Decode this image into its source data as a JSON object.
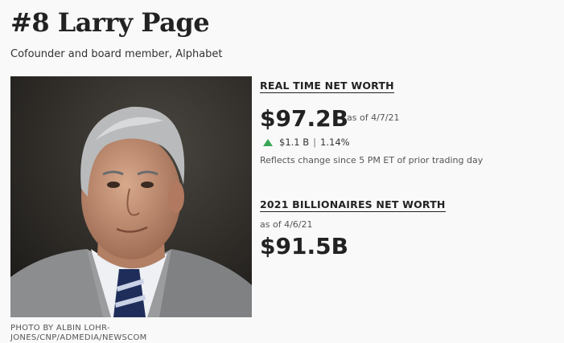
{
  "profile": {
    "rank_name": "#8 Larry Page",
    "subtitle": "Cofounder and board member, Alphabet",
    "photo_credit": "PHOTO BY ALBIN LOHR-JONES/CNP/ADMEDIA/NEWSCOM"
  },
  "realtime": {
    "label": "REAL TIME NET WORTH",
    "value": "$97.2B",
    "as_of": "as of 4/7/21",
    "change_amount": "$1.1 B",
    "change_sep": "|",
    "change_pct": "1.14%",
    "change_direction": "up",
    "note": "Reflects change since 5 PM ET of prior trading day"
  },
  "annual": {
    "label": "2021 BILLIONAIRES NET WORTH",
    "as_of": "as of 4/6/21",
    "value": "$91.5B"
  },
  "colors": {
    "up": "#3aa655",
    "text": "#222222",
    "background": "#f9f9f9"
  }
}
